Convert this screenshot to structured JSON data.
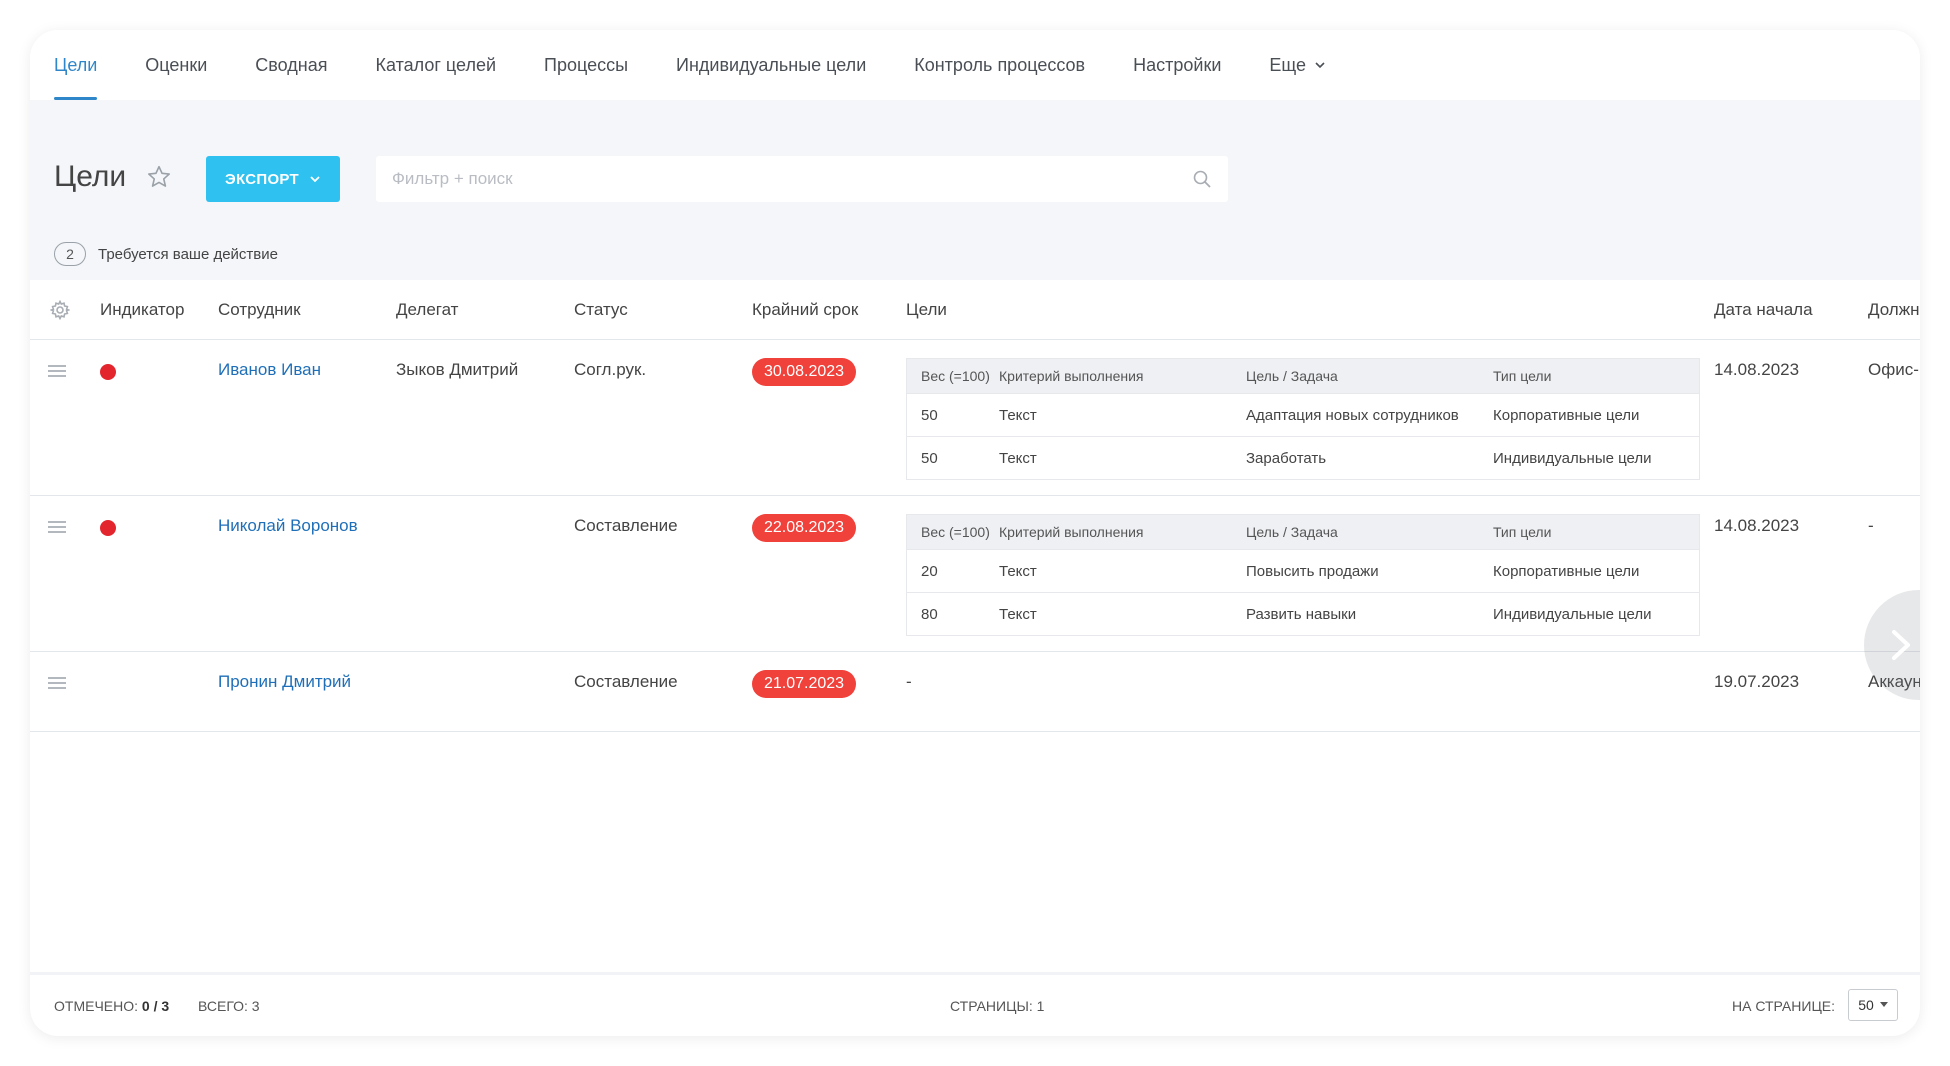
{
  "nav": {
    "items": [
      {
        "label": "Цели",
        "active": true
      },
      {
        "label": "Оценки"
      },
      {
        "label": "Сводная"
      },
      {
        "label": "Каталог целей"
      },
      {
        "label": "Процессы"
      },
      {
        "label": "Индивидуальные цели"
      },
      {
        "label": "Контроль процессов"
      },
      {
        "label": "Настройки"
      },
      {
        "label": "Еще"
      }
    ]
  },
  "header": {
    "title": "Цели",
    "export_label": "ЭКСПОРТ",
    "search_placeholder": "Фильтр + поиск"
  },
  "action_required": {
    "count": "2",
    "text": "Требуется ваше действие"
  },
  "table": {
    "columns": [
      "Индикатор",
      "Сотрудник",
      "Делегат",
      "Статус",
      "Крайний срок",
      "Цели",
      "Дата начала",
      "Должно"
    ],
    "goal_columns": [
      "Вес (=100)",
      "Критерий выполнения",
      "Цель / Задача",
      "Тип цели"
    ],
    "rows": [
      {
        "indicator": "red",
        "employee": "Иванов Иван",
        "delegate": "Зыков Дмитрий",
        "status": "Согл.рук.",
        "deadline": "30.08.2023",
        "goals": [
          {
            "weight": "50",
            "criterion": "Текст",
            "task": "Адаптация новых сотрудников",
            "type": "Корпоративные цели"
          },
          {
            "weight": "50",
            "criterion": "Текст",
            "task": "Заработать",
            "type": "Индивидуальные цели"
          }
        ],
        "start_date": "14.08.2023",
        "position": "Офис-м"
      },
      {
        "indicator": "red",
        "employee": "Николай Воронов",
        "delegate": "",
        "status": "Составление",
        "deadline": "22.08.2023",
        "goals": [
          {
            "weight": "20",
            "criterion": "Текст",
            "task": "Повысить продажи",
            "type": "Корпоративные цели"
          },
          {
            "weight": "80",
            "criterion": "Текст",
            "task": "Развить навыки",
            "type": "Индивидуальные цели"
          }
        ],
        "start_date": "14.08.2023",
        "position": "-"
      },
      {
        "indicator": "",
        "employee": "Пронин Дмитрий",
        "delegate": "",
        "status": "Составление",
        "deadline": "21.07.2023",
        "goals_empty": "-",
        "start_date": "19.07.2023",
        "position": "Аккаунт"
      }
    ]
  },
  "footer": {
    "checked_label": "ОТМЕЧЕНО:",
    "checked_value": "0 / 3",
    "total": "ВСЕГО: 3",
    "pages": "СТРАНИЦЫ: 1",
    "per_page_label": "НА СТРАНИЦЕ:",
    "per_page_value": "50"
  },
  "colors": {
    "accent": "#2f86c9",
    "export_button": "#2fc1ef",
    "deadline_badge": "#f0413b",
    "indicator_red": "#e3262e",
    "link": "#1f6fb8"
  },
  "icons": [
    "chevron-down-icon",
    "star-icon",
    "search-icon",
    "gear-icon",
    "drag-handle-icon",
    "chevron-right-icon"
  ]
}
